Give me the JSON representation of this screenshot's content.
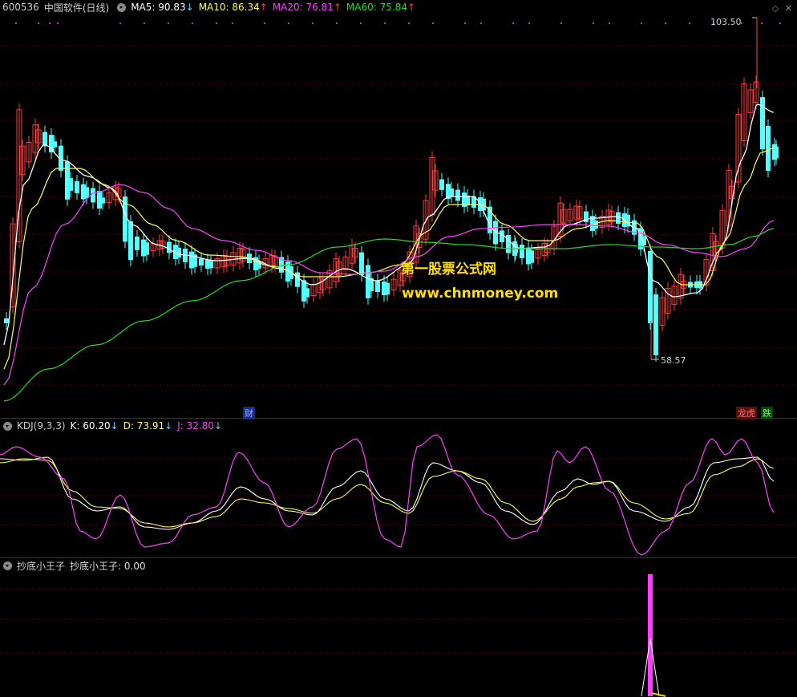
{
  "main": {
    "symbol": "600536",
    "name": "中国软件",
    "period": "(日线)",
    "ma5_label": "MA5: 90.83",
    "ma10_label": "MA10: 86.34",
    "ma20_label": "MA20: 76.81",
    "ma60_label": "MA60: 75.84",
    "ma5_dir": "↓",
    "ma10_dir": "↑",
    "ma20_dir": "↑",
    "ma60_dir": "↑",
    "high_label": "103.50",
    "low_label": "58.57",
    "tag_cai": "财",
    "tag_longhu": "龙虎",
    "tag_die": "跌",
    "watermark_cn": "第一股票公式网",
    "watermark_url": "www.chnmoney.com",
    "colors": {
      "up": "#ff3b3b",
      "down": "#54ffff",
      "ma5": "#ffffff",
      "ma10": "#ffff55",
      "ma20": "#ff40ff",
      "ma60": "#22dd22"
    }
  },
  "kdj": {
    "label": "KDJ(9,3,3)",
    "k_label": "K: 60.20",
    "d_label": "D: 73.91",
    "j_label": "J: 32.80",
    "k_dir": "↓",
    "d_dir": "↓",
    "j_dir": "↓"
  },
  "bottom": {
    "label": "抄底小王子",
    "value_label": "抄底小王子: 0.00"
  }
}
